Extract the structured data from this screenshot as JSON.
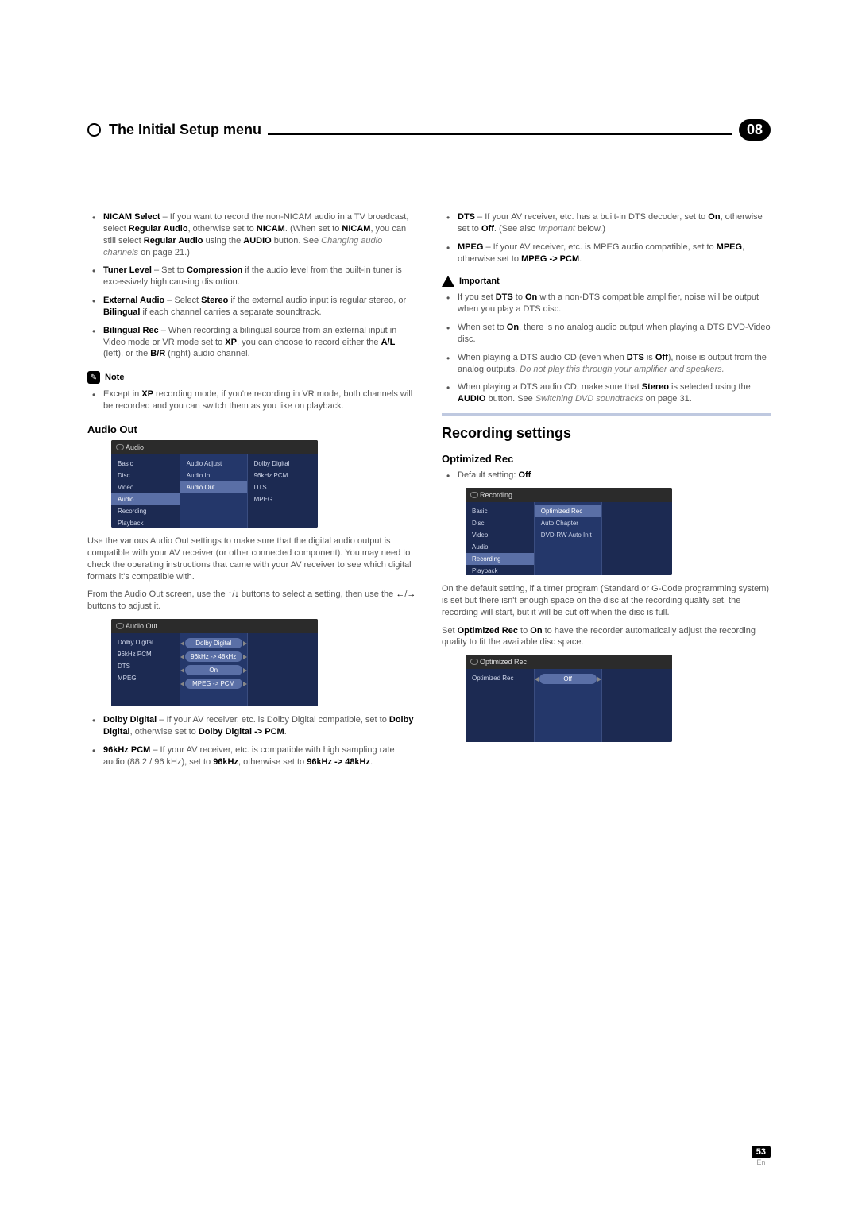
{
  "header": {
    "title": "The Initial Setup menu",
    "chapter": "08"
  },
  "left": {
    "bullets1": {
      "nicam_prefix": "NICAM Select",
      "nicam_text1": " – If you want to record the non-NICAM audio in a TV broadcast, select ",
      "nicam_b1": "Regular Audio",
      "nicam_text2": ", otherwise set to ",
      "nicam_b2": "NICAM",
      "nicam_text3": ". (When set to ",
      "nicam_b3": "NICAM",
      "nicam_text4": ", you can still select ",
      "nicam_b4": "Regular Audio",
      "nicam_text5": " using the ",
      "nicam_b5": "AUDIO",
      "nicam_text6": " button. See ",
      "nicam_it": "Changing audio channels",
      "nicam_text7": " on page 21.)",
      "tuner_prefix": "Tuner Level",
      "tuner_text1": " – Set to ",
      "tuner_b1": "Compression",
      "tuner_text2": " if the audio level from the built-in tuner is excessively high causing distortion.",
      "ext_prefix": "External Audio",
      "ext_text1": " – Select ",
      "ext_b1": "Stereo",
      "ext_text2": " if the external audio input is regular stereo, or ",
      "ext_b2": "Bilingual",
      "ext_text3": " if each channel carries a separate soundtrack.",
      "bil_prefix": "Bilingual Rec",
      "bil_text1": " – When recording a bilingual source from an external input in Video mode or VR mode set to ",
      "bil_b1": "XP",
      "bil_text2": ", you can choose to record either the ",
      "bil_b2": "A/L",
      "bil_text3": " (left), or the ",
      "bil_b3": "B/R",
      "bil_text4": " (right) audio channel."
    },
    "note_label": "Note",
    "note_text1": "Except in ",
    "note_b1": "XP",
    "note_text2": " recording mode, if you're recording in VR mode, both channels will be recorded and you can switch them as you like on playback.",
    "audio_out_h": "Audio Out",
    "screenshot1": {
      "title": "Audio",
      "nav": [
        "Basic",
        "Disc",
        "Video",
        "Audio",
        "Recording",
        "Playback"
      ],
      "mid": [
        "Audio Adjust",
        "Audio In",
        "Audio Out"
      ],
      "right": [
        "Dolby Digital",
        "96kHz PCM",
        "DTS",
        "MPEG"
      ]
    },
    "audio_out_p1": "Use the various Audio Out settings to make sure that the digital audio output is compatible with your AV receiver (or other connected component). You may need to check the operating instructions that came with your AV receiver to see which digital formats it's compatible with.",
    "audio_out_p2a": "From the Audio Out screen, use the ",
    "audio_out_p2b": " buttons to select a setting, then use the ",
    "audio_out_p2c": " buttons to adjust it.",
    "screenshot2": {
      "title": "Audio Out",
      "left": [
        "Dolby Digital",
        "96kHz PCM",
        "DTS",
        "MPEG"
      ],
      "right": [
        "Dolby Digital",
        "96kHz -> 48kHz",
        "On",
        "MPEG -> PCM"
      ]
    },
    "bullets2": {
      "dd_prefix": "Dolby Digital",
      "dd_text1": " – If your AV receiver, etc. is Dolby Digital compatible, set to ",
      "dd_b1": "Dolby Digital",
      "dd_text2": ", otherwise set to ",
      "dd_b2": "Dolby Digital -> PCM",
      "dd_text3": ".",
      "pcm_prefix": "96kHz PCM",
      "pcm_text1": " – If your AV receiver, etc. is compatible with high sampling rate audio (88.2 / 96 kHz), set to ",
      "pcm_b1": "96kHz",
      "pcm_text2": ", otherwise set to ",
      "pcm_b2": "96kHz -> 48kHz",
      "pcm_text3": "."
    }
  },
  "right": {
    "bullets1": {
      "dts_prefix": "DTS",
      "dts_text1": " – If your AV receiver, etc. has a built-in DTS decoder, set to ",
      "dts_b1": "On",
      "dts_text2": ", otherwise set to ",
      "dts_b2": "Off",
      "dts_text3": ". (See also ",
      "dts_it": "Important",
      "dts_text4": " below.)",
      "mpeg_prefix": "MPEG",
      "mpeg_text1": " – If your AV receiver, etc. is MPEG audio compatible, set to ",
      "mpeg_b1": "MPEG",
      "mpeg_text2": ", otherwise set to ",
      "mpeg_b2": "MPEG -> PCM",
      "mpeg_text3": "."
    },
    "important_label": "Important",
    "important": {
      "i1a": "If you set ",
      "i1b": "DTS",
      "i1c": " to ",
      "i1d": "On",
      "i1e": " with a non-DTS compatible amplifier, noise will be output when you play a DTS disc.",
      "i2a": "When set to ",
      "i2b": "On",
      "i2c": ", there is no analog audio output when playing a DTS DVD-Video disc.",
      "i3a": "When playing a DTS audio CD (even when ",
      "i3b": "DTS",
      "i3c": " is ",
      "i3d": "Off",
      "i3e": "), noise is output from the analog outputs. ",
      "i3it": "Do not play this through your amplifier and speakers.",
      "i4a": "When playing a DTS audio CD, make sure that ",
      "i4b": "Stereo",
      "i4c": " is selected using the ",
      "i4d": "AUDIO",
      "i4e": " button. See ",
      "i4it": "Switching DVD soundtracks",
      "i4f": " on page 31."
    },
    "h2": "Recording settings",
    "optrec_h": "Optimized Rec",
    "optrec_default_a": "Default setting: ",
    "optrec_default_b": "Off",
    "screenshot3": {
      "title": "Recording",
      "nav": [
        "Basic",
        "Disc",
        "Video",
        "Audio",
        "Recording",
        "Playback"
      ],
      "mid": [
        "Optimized Rec",
        "Auto Chapter",
        "DVD-RW Auto Init"
      ]
    },
    "optrec_p1": "On the default setting, if a timer program (Standard or G-Code programming system) is set but there isn't enough space on the disc at the recording quality set, the recording will start, but it will be cut off when the disc is full.",
    "optrec_p2a": "Set ",
    "optrec_p2b": "Optimized Rec",
    "optrec_p2c": " to ",
    "optrec_p2d": "On",
    "optrec_p2e": " to have the recorder automatically adjust the recording quality to fit the available disc space.",
    "screenshot4": {
      "title": "Optimized Rec",
      "left": [
        "Optimized Rec"
      ],
      "pill": "Off"
    }
  },
  "footer": {
    "page": "53",
    "lang": "En"
  }
}
